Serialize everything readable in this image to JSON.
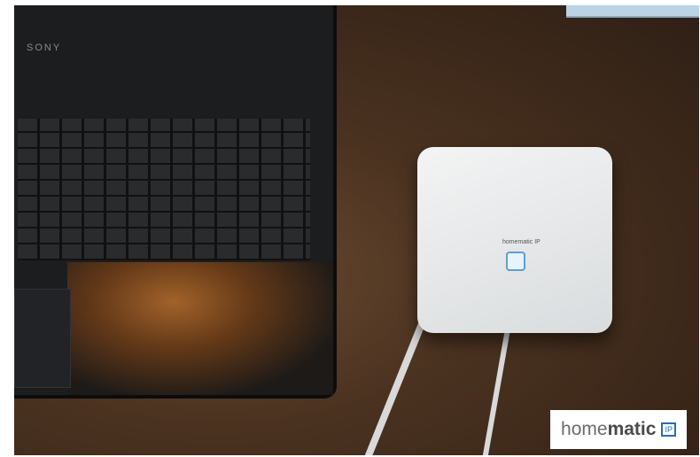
{
  "photo": {
    "laptop_brand": "SONY",
    "device_label": "homematic",
    "device_mark": "IP"
  },
  "logo": {
    "text_light": "home",
    "text_bold": "matic",
    "mark": "IP"
  },
  "colors": {
    "brand_blue": "#2b6cb0",
    "desk": "#4a3220",
    "device": "#e8eaeb"
  }
}
